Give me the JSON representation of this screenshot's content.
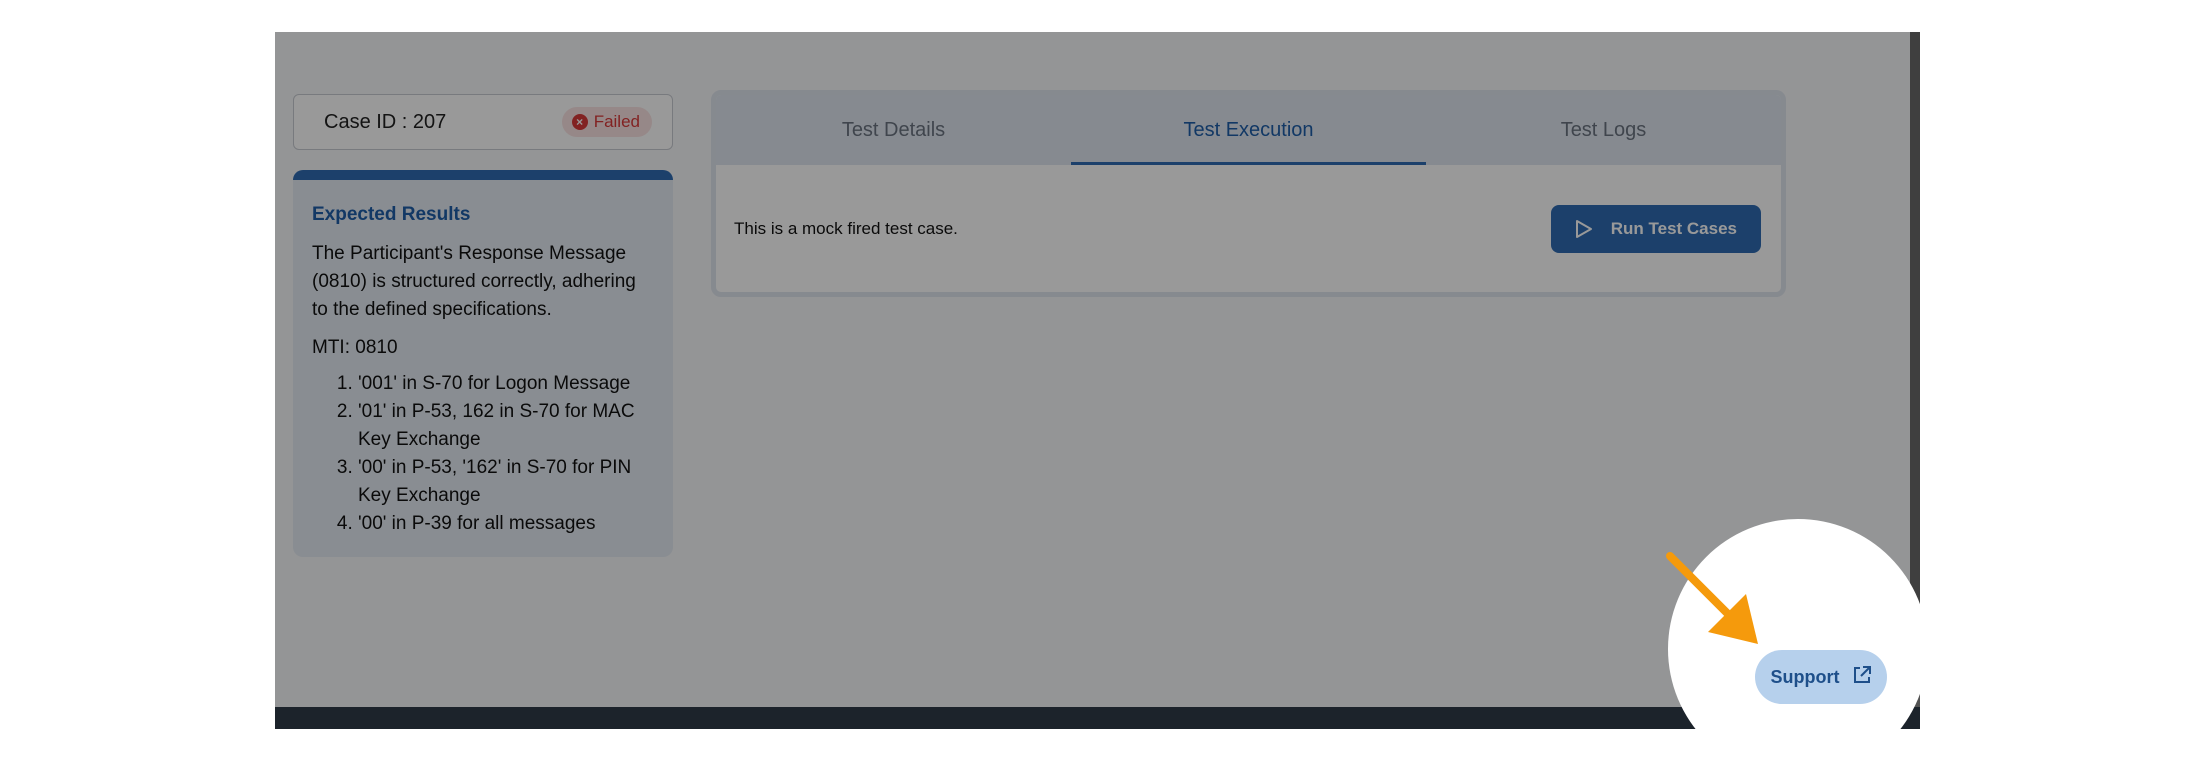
{
  "case": {
    "id_label": "Case ID : 207",
    "status": "Failed",
    "status_color": "#d93a3a"
  },
  "expected": {
    "title": "Expected Results",
    "description": "The Participant's Response Message (0810) is structured correctly, adhering to the defined specifications.",
    "mti": "MTI: 0810",
    "items": [
      "'001' in S-70 for Logon Message",
      "'01' in P-53, 162 in S-70 for MAC Key Exchange",
      "'00' in P-53, '162' in S-70 for PIN Key Exchange",
      "'00' in P-39 for all messages"
    ]
  },
  "tabs": [
    {
      "label": "Test Details",
      "active": false
    },
    {
      "label": "Test Execution",
      "active": true
    },
    {
      "label": "Test Logs",
      "active": false
    }
  ],
  "execution": {
    "message": "This is a mock fired test case.",
    "run_label": "Run Test Cases",
    "run_icon": "play-icon"
  },
  "support": {
    "label": "Support",
    "icon": "external-link-icon"
  },
  "colors": {
    "accent": "#2f6cb3",
    "highlight_arrow": "#f59a0c"
  }
}
